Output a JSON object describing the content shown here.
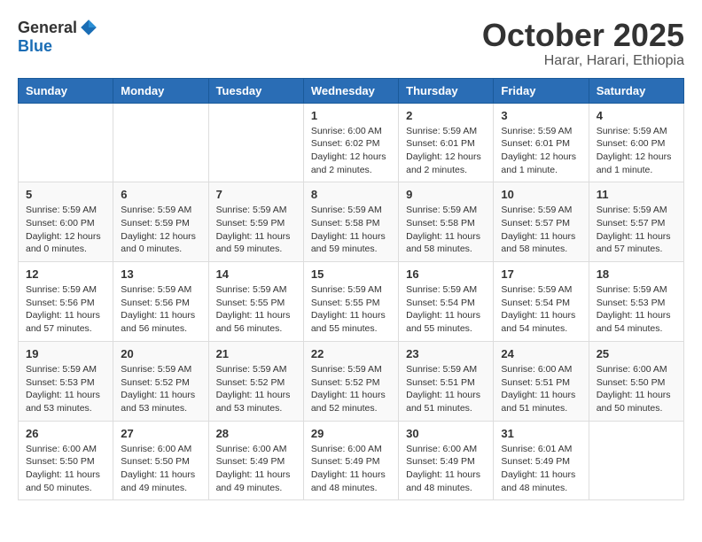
{
  "header": {
    "logo": {
      "line1": "General",
      "line2": "Blue"
    },
    "title": "October 2025",
    "location": "Harar, Harari, Ethiopia"
  },
  "weekdays": [
    "Sunday",
    "Monday",
    "Tuesday",
    "Wednesday",
    "Thursday",
    "Friday",
    "Saturday"
  ],
  "weeks": [
    [
      {
        "day": "",
        "info": ""
      },
      {
        "day": "",
        "info": ""
      },
      {
        "day": "",
        "info": ""
      },
      {
        "day": "1",
        "info": "Sunrise: 6:00 AM\nSunset: 6:02 PM\nDaylight: 12 hours\nand 2 minutes."
      },
      {
        "day": "2",
        "info": "Sunrise: 5:59 AM\nSunset: 6:01 PM\nDaylight: 12 hours\nand 2 minutes."
      },
      {
        "day": "3",
        "info": "Sunrise: 5:59 AM\nSunset: 6:01 PM\nDaylight: 12 hours\nand 1 minute."
      },
      {
        "day": "4",
        "info": "Sunrise: 5:59 AM\nSunset: 6:00 PM\nDaylight: 12 hours\nand 1 minute."
      }
    ],
    [
      {
        "day": "5",
        "info": "Sunrise: 5:59 AM\nSunset: 6:00 PM\nDaylight: 12 hours\nand 0 minutes."
      },
      {
        "day": "6",
        "info": "Sunrise: 5:59 AM\nSunset: 5:59 PM\nDaylight: 12 hours\nand 0 minutes."
      },
      {
        "day": "7",
        "info": "Sunrise: 5:59 AM\nSunset: 5:59 PM\nDaylight: 11 hours\nand 59 minutes."
      },
      {
        "day": "8",
        "info": "Sunrise: 5:59 AM\nSunset: 5:58 PM\nDaylight: 11 hours\nand 59 minutes."
      },
      {
        "day": "9",
        "info": "Sunrise: 5:59 AM\nSunset: 5:58 PM\nDaylight: 11 hours\nand 58 minutes."
      },
      {
        "day": "10",
        "info": "Sunrise: 5:59 AM\nSunset: 5:57 PM\nDaylight: 11 hours\nand 58 minutes."
      },
      {
        "day": "11",
        "info": "Sunrise: 5:59 AM\nSunset: 5:57 PM\nDaylight: 11 hours\nand 57 minutes."
      }
    ],
    [
      {
        "day": "12",
        "info": "Sunrise: 5:59 AM\nSunset: 5:56 PM\nDaylight: 11 hours\nand 57 minutes."
      },
      {
        "day": "13",
        "info": "Sunrise: 5:59 AM\nSunset: 5:56 PM\nDaylight: 11 hours\nand 56 minutes."
      },
      {
        "day": "14",
        "info": "Sunrise: 5:59 AM\nSunset: 5:55 PM\nDaylight: 11 hours\nand 56 minutes."
      },
      {
        "day": "15",
        "info": "Sunrise: 5:59 AM\nSunset: 5:55 PM\nDaylight: 11 hours\nand 55 minutes."
      },
      {
        "day": "16",
        "info": "Sunrise: 5:59 AM\nSunset: 5:54 PM\nDaylight: 11 hours\nand 55 minutes."
      },
      {
        "day": "17",
        "info": "Sunrise: 5:59 AM\nSunset: 5:54 PM\nDaylight: 11 hours\nand 54 minutes."
      },
      {
        "day": "18",
        "info": "Sunrise: 5:59 AM\nSunset: 5:53 PM\nDaylight: 11 hours\nand 54 minutes."
      }
    ],
    [
      {
        "day": "19",
        "info": "Sunrise: 5:59 AM\nSunset: 5:53 PM\nDaylight: 11 hours\nand 53 minutes."
      },
      {
        "day": "20",
        "info": "Sunrise: 5:59 AM\nSunset: 5:52 PM\nDaylight: 11 hours\nand 53 minutes."
      },
      {
        "day": "21",
        "info": "Sunrise: 5:59 AM\nSunset: 5:52 PM\nDaylight: 11 hours\nand 53 minutes."
      },
      {
        "day": "22",
        "info": "Sunrise: 5:59 AM\nSunset: 5:52 PM\nDaylight: 11 hours\nand 52 minutes."
      },
      {
        "day": "23",
        "info": "Sunrise: 5:59 AM\nSunset: 5:51 PM\nDaylight: 11 hours\nand 51 minutes."
      },
      {
        "day": "24",
        "info": "Sunrise: 6:00 AM\nSunset: 5:51 PM\nDaylight: 11 hours\nand 51 minutes."
      },
      {
        "day": "25",
        "info": "Sunrise: 6:00 AM\nSunset: 5:50 PM\nDaylight: 11 hours\nand 50 minutes."
      }
    ],
    [
      {
        "day": "26",
        "info": "Sunrise: 6:00 AM\nSunset: 5:50 PM\nDaylight: 11 hours\nand 50 minutes."
      },
      {
        "day": "27",
        "info": "Sunrise: 6:00 AM\nSunset: 5:50 PM\nDaylight: 11 hours\nand 49 minutes."
      },
      {
        "day": "28",
        "info": "Sunrise: 6:00 AM\nSunset: 5:49 PM\nDaylight: 11 hours\nand 49 minutes."
      },
      {
        "day": "29",
        "info": "Sunrise: 6:00 AM\nSunset: 5:49 PM\nDaylight: 11 hours\nand 48 minutes."
      },
      {
        "day": "30",
        "info": "Sunrise: 6:00 AM\nSunset: 5:49 PM\nDaylight: 11 hours\nand 48 minutes."
      },
      {
        "day": "31",
        "info": "Sunrise: 6:01 AM\nSunset: 5:49 PM\nDaylight: 11 hours\nand 48 minutes."
      },
      {
        "day": "",
        "info": ""
      }
    ]
  ]
}
